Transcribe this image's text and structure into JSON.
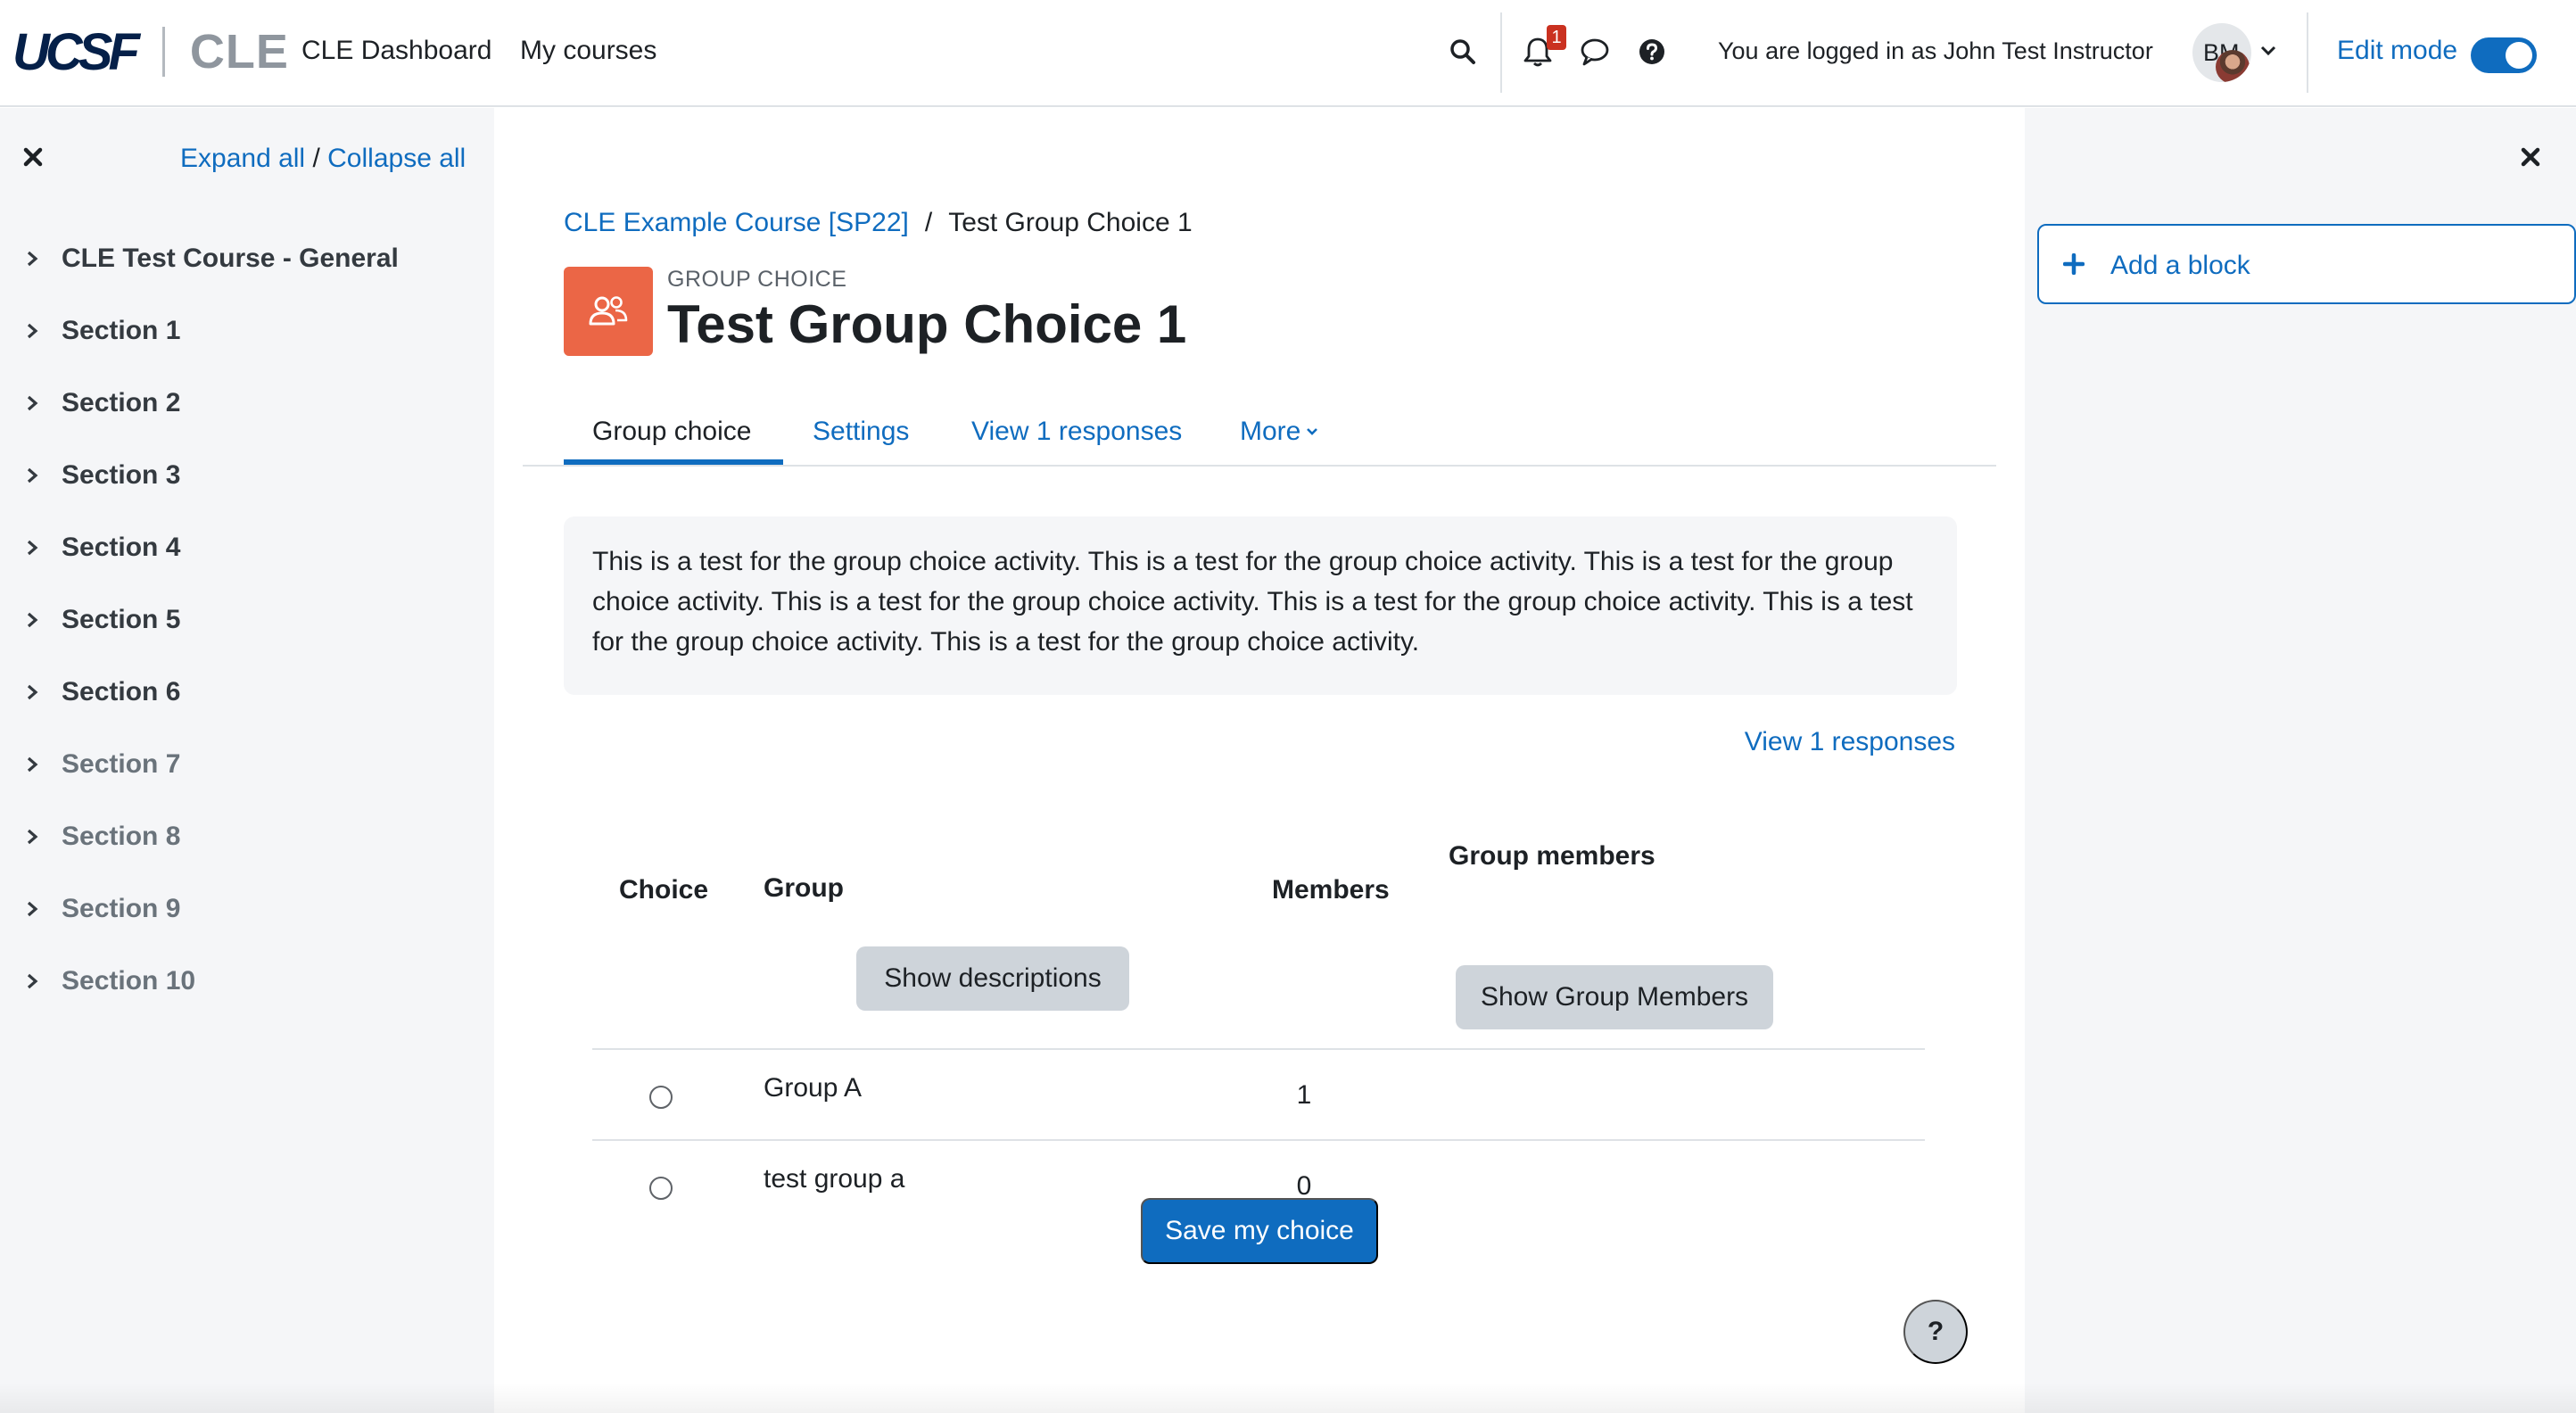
{
  "navbar": {
    "logo_primary": "UCSF",
    "logo_secondary": "CLE",
    "links": [
      "CLE Dashboard",
      "My courses"
    ],
    "notification_count": "1",
    "logged_in_text": "You are logged in as John Test Instructor",
    "avatar_initials": "BM",
    "edit_mode_label": "Edit mode",
    "edit_mode_on": true
  },
  "drawer_left": {
    "expand_all": "Expand all",
    "separator": "/",
    "collapse_all": "Collapse all",
    "items": [
      {
        "label": "CLE Test Course - General",
        "dim": false
      },
      {
        "label": "Section 1",
        "dim": false
      },
      {
        "label": "Section 2",
        "dim": false
      },
      {
        "label": "Section 3",
        "dim": false
      },
      {
        "label": "Section 4",
        "dim": false
      },
      {
        "label": "Section 5",
        "dim": false
      },
      {
        "label": "Section 6",
        "dim": false
      },
      {
        "label": "Section 7",
        "dim": true
      },
      {
        "label": "Section 8",
        "dim": true
      },
      {
        "label": "Section 9",
        "dim": true
      },
      {
        "label": "Section 10",
        "dim": true
      }
    ]
  },
  "main": {
    "breadcrumb": {
      "course": "CLE Example Course [SP22]",
      "separator": "/",
      "current": "Test Group Choice 1"
    },
    "activity_type": "GROUP CHOICE",
    "title": "Test Group Choice 1",
    "tabs": {
      "group_choice": "Group choice",
      "settings": "Settings",
      "view_responses": "View 1 responses",
      "more": "More"
    },
    "intro": "This is a test for the group choice activity. This is a test for the group choice activity. This is a test for the group choice activity. This is a test for the group choice activity. This is a test for the group choice activity. This is a test for the group choice activity. This is a test for the group choice activity.",
    "view_responses_link": "View 1 responses",
    "table": {
      "headers": {
        "choice": "Choice",
        "group": "Group",
        "members": "Members",
        "group_members": "Group members"
      },
      "show_descriptions": "Show descriptions",
      "show_group_members": "Show Group Members",
      "rows": [
        {
          "group": "Group A",
          "members": "1"
        },
        {
          "group": "test group a",
          "members": "0"
        }
      ]
    },
    "save_button": "Save my choice",
    "help_button": "?"
  },
  "drawer_right": {
    "add_block": "Add a block"
  },
  "colors": {
    "accent": "#0f6cbf",
    "activity_icon": "#eb6646",
    "badge": "#ca3120"
  }
}
